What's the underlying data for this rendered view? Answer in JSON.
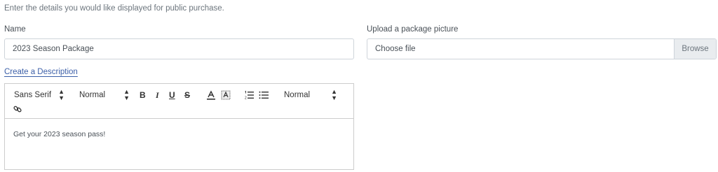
{
  "intro": "Enter the details you would like displayed for public purchase.",
  "name": {
    "label": "Name",
    "value": "2023 Season Package"
  },
  "upload": {
    "label": "Upload a package picture",
    "placeholder": "Choose file",
    "browse": "Browse"
  },
  "description": {
    "link": "Create a Description",
    "toolbar": {
      "font": "Sans Serif",
      "size": "Normal",
      "bold": "B",
      "italic": "I",
      "underline": "U",
      "strike": "S",
      "header": "Normal",
      "icons": [
        "bold-icon",
        "italic-icon",
        "underline-icon",
        "strike-icon",
        "text-color-icon",
        "background-color-icon",
        "ordered-list-icon",
        "bullet-list-icon",
        "link-icon"
      ]
    },
    "content": "Get your 2023 season pass!"
  }
}
